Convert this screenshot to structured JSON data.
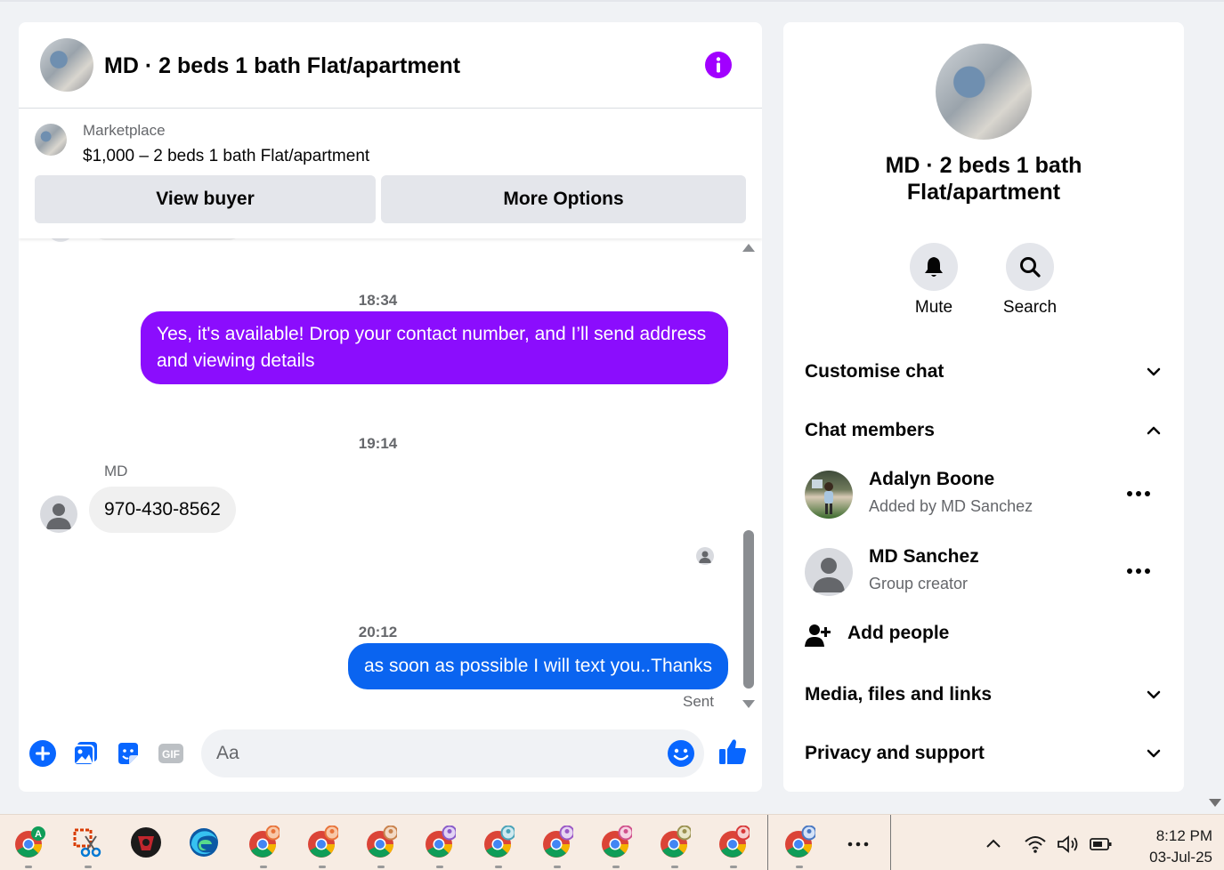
{
  "chat": {
    "title": "MD · 2 beds 1 bath Flat/apartment",
    "listing": {
      "label": "Marketplace",
      "title": "$1,000 – 2 beds 1 bath Flat/apartment",
      "view_buyer": "View buyer",
      "more_options": "More Options"
    },
    "messages": {
      "time1": "18:34",
      "out1": "Yes, it's available! Drop your contact number, and I’ll send address and viewing details",
      "time2": "19:14",
      "sender": "MD",
      "in1": "970-430-8562",
      "time3": "20:12",
      "out2": "as soon as possible I will text you..Thanks",
      "status": "Sent"
    },
    "composer": {
      "placeholder": "Aa"
    }
  },
  "info": {
    "title": "MD · 2 beds 1 bath Flat/apartment",
    "actions": {
      "mute": "Mute",
      "search": "Search"
    },
    "sections": {
      "customise": "Customise chat",
      "members": "Chat members",
      "media": "Media, files and links",
      "privacy": "Privacy and support"
    },
    "members": [
      {
        "name": "Adalyn Boone",
        "sub": "Added by MD Sanchez"
      },
      {
        "name": "MD Sanchez",
        "sub": "Group creator"
      }
    ],
    "add_people": "Add people"
  },
  "taskbar": {
    "time": "8:12 PM",
    "date": "03-Jul-25"
  },
  "colors": {
    "accent_purple": "#8b0dfd",
    "accent_blue": "#0a64f0",
    "messenger_blue": "#0866ff",
    "info_purple": "#a100ff"
  },
  "icons": [
    "info-icon",
    "plus-icon",
    "image-icon",
    "sticker-icon",
    "gif-icon",
    "emoji-icon",
    "thumbs-up-icon",
    "bell-icon",
    "search-icon",
    "chevron-down-icon",
    "chevron-up-icon",
    "more-icon",
    "add-person-icon"
  ]
}
